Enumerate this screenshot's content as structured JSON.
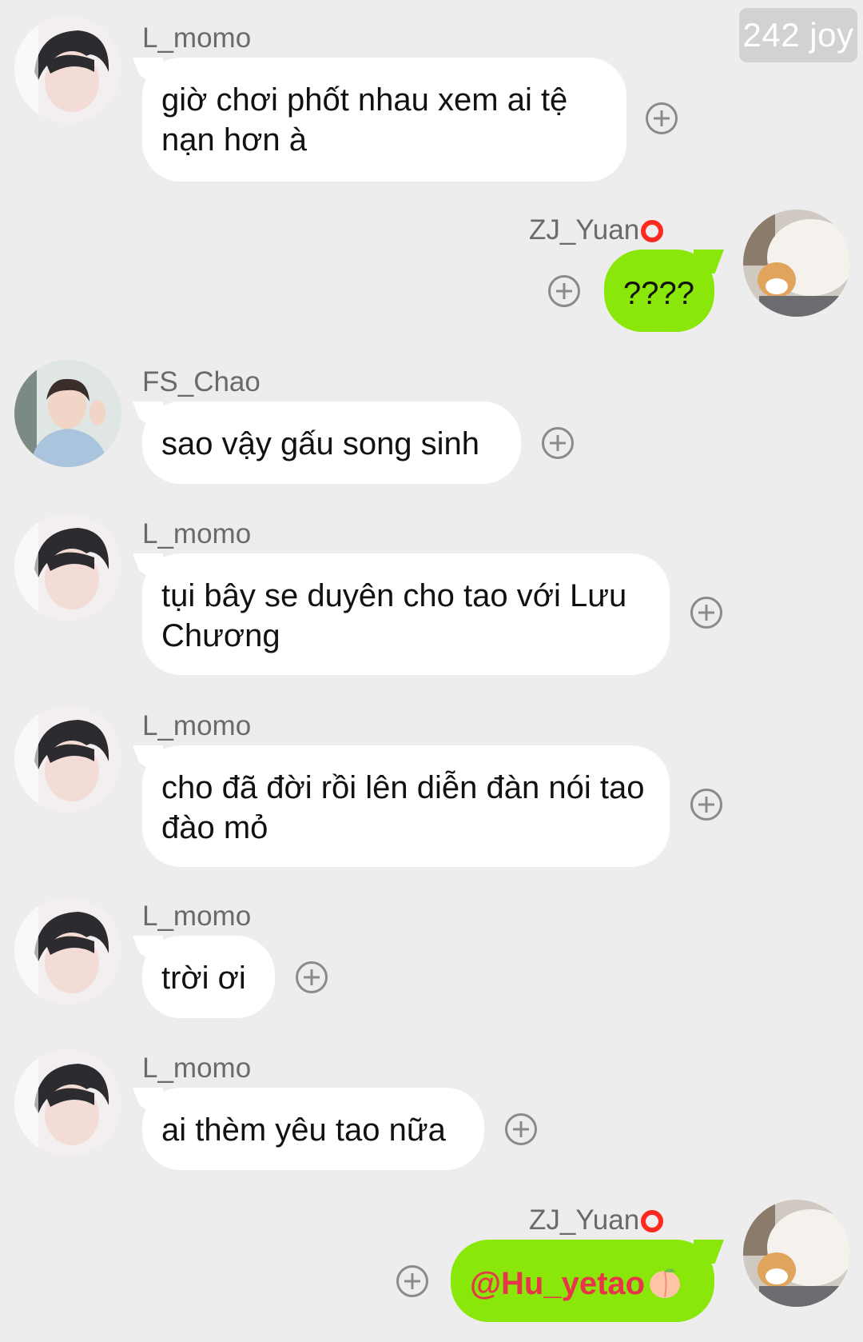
{
  "watermark": "242 joy",
  "messages": [
    {
      "sender": "L_momo",
      "side": "left",
      "text": "giờ chơi phốt nhau xem ai tệ nạn hơn à",
      "avatar": "boy-avatar"
    },
    {
      "sender": "ZJ_Yuan",
      "side": "right",
      "text": "????",
      "avatar": "cat-avatar",
      "badge": "red-ring-icon"
    },
    {
      "sender": "FS_Chao",
      "side": "left",
      "text": "sao vậy gấu song sinh",
      "avatar": "man-hoodie-avatar"
    },
    {
      "sender": "L_momo",
      "side": "left",
      "text": "tụi bây se duyên cho tao với Lưu Chương",
      "avatar": "boy-avatar"
    },
    {
      "sender": "L_momo",
      "side": "left",
      "text": "cho đã đời rồi lên diễn đàn nói tao đào mỏ",
      "avatar": "boy-avatar"
    },
    {
      "sender": "L_momo",
      "side": "left",
      "text": "trời ơi",
      "avatar": "boy-avatar"
    },
    {
      "sender": "L_momo",
      "side": "left",
      "text": "ai thèm yêu tao nữa",
      "avatar": "boy-avatar"
    },
    {
      "sender": "ZJ_Yuan",
      "side": "right",
      "text": "@Hu_yetao",
      "avatar": "cat-avatar",
      "badge": "red-ring-icon",
      "emoji": "peach-icon"
    }
  ],
  "colors": {
    "background": "#ededed",
    "my_bubble": "#89e80a",
    "their_bubble": "#ffffff",
    "mention": "#e8354a",
    "ring": "#ff2a1f"
  }
}
